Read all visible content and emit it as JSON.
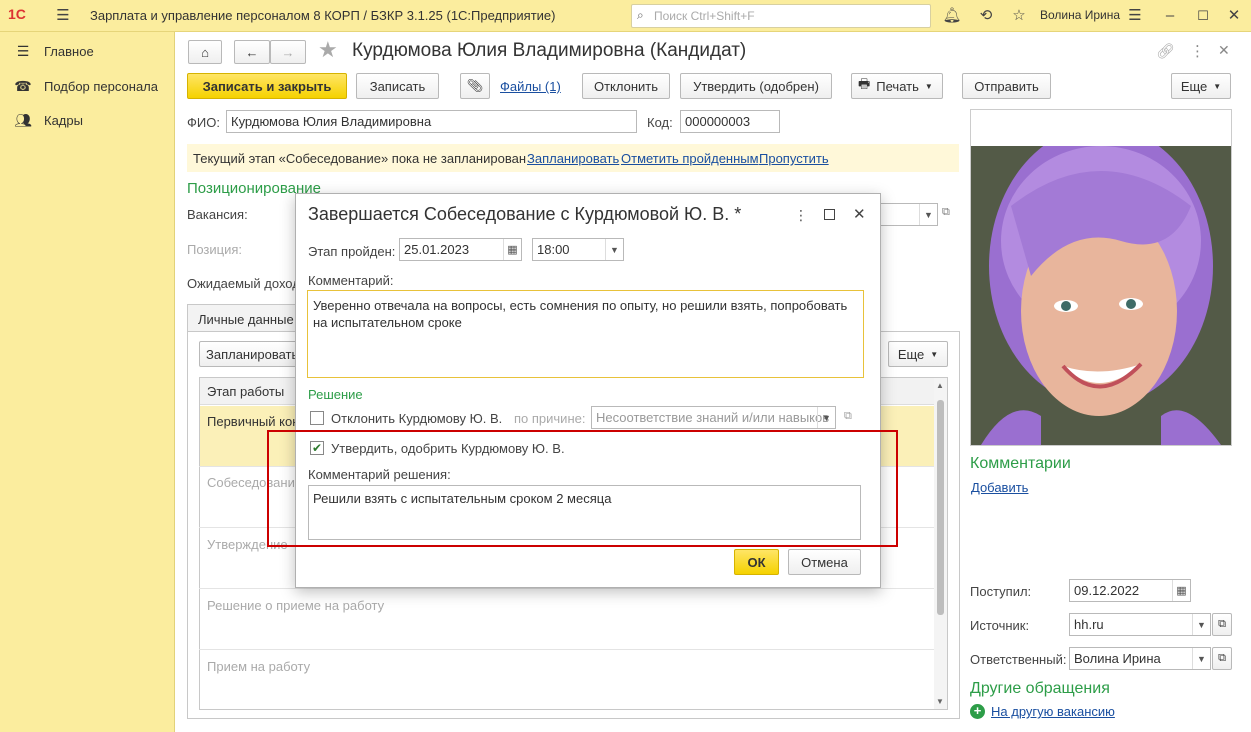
{
  "titlebar": {
    "app_title": "Зарплата и управление персоналом 8 КОРП / БЗКР 3.1.25  (1С:Предприятие)",
    "search_placeholder": "Поиск Ctrl+Shift+F",
    "user_name": "Волина Ирина"
  },
  "sidebar": {
    "items": [
      {
        "label": "Главное",
        "icon": "menu-icon"
      },
      {
        "label": "Подбор персонала",
        "icon": "headset-icon"
      },
      {
        "label": "Кадры",
        "icon": "people-icon"
      }
    ]
  },
  "form": {
    "title": "Курдюмова Юлия Владимировна (Кандидат)",
    "toolbar": {
      "save_close": "Записать и закрыть",
      "save": "Записать",
      "files": "Файлы (1)",
      "reject": "Отклонить",
      "approve": "Утвердить (одобрен)",
      "print": "Печать",
      "send": "Отправить",
      "more": "Еще"
    },
    "fio_label": "ФИО:",
    "fio_value": "Курдюмова Юлия Владимировна",
    "code_label": "Код:",
    "code_value": "000000003",
    "stage_notice": "Текущий этап «Собеседование» пока не запланирован",
    "stage_links": [
      "Запланировать",
      "Отметить пройденным",
      "Пропустить"
    ],
    "positioning_header": "Позиционирование",
    "vacancy_label": "Вакансия:",
    "position_label": "Позиция:",
    "income_label": "Ожидаемый доход:",
    "tab_personal": "Личные данные",
    "plan_button": "Запланировать",
    "more_button": "Еще",
    "table": {
      "header": "Этап работы",
      "rows": [
        "Первичный контакт",
        "Собеседование",
        "Утверждение",
        "Решение о приеме на работу",
        "Прием на работу"
      ]
    }
  },
  "right_panel": {
    "comments_header": "Комментарии",
    "add_link": "Добавить",
    "received_label": "Поступил:",
    "received_value": "09.12.2022",
    "source_label": "Источник:",
    "source_value": "hh.ru",
    "responsible_label": "Ответственный:",
    "responsible_value": "Волина Ирина",
    "other_header": "Другие обращения",
    "other_link": "На другую вакансию"
  },
  "dialog": {
    "title": "Завершается Собеседование с Курдюмовой Ю. В. *",
    "stage_passed_label": "Этап пройден:",
    "date_value": "25.01.2023",
    "time_value": "18:00",
    "comment_label": "Комментарий:",
    "comment_value": "Уверенно отвечала на вопросы, есть сомнения по опыту, но решили взять, попробовать на испытательном сроке",
    "decision_header": "Решение",
    "reject_label": "Отклонить Курдюмову Ю. В.",
    "reason_label": "по причине:",
    "reason_value": "Несоответствие знаний и/или навыков",
    "approve_label": "Утвердить, одобрить Курдюмову Ю. В.",
    "decision_comment_label": "Комментарий решения:",
    "decision_comment_value": "Решили взять с испытательным сроком 2 месяца",
    "ok": "ОК",
    "cancel": "Отмена"
  },
  "colors": {
    "accent_yellow": "#fbed9e",
    "button_yellow": "#f5d200",
    "green": "#2d9d48",
    "link": "#1a4fa0",
    "highlight_red": "#cc0000"
  }
}
